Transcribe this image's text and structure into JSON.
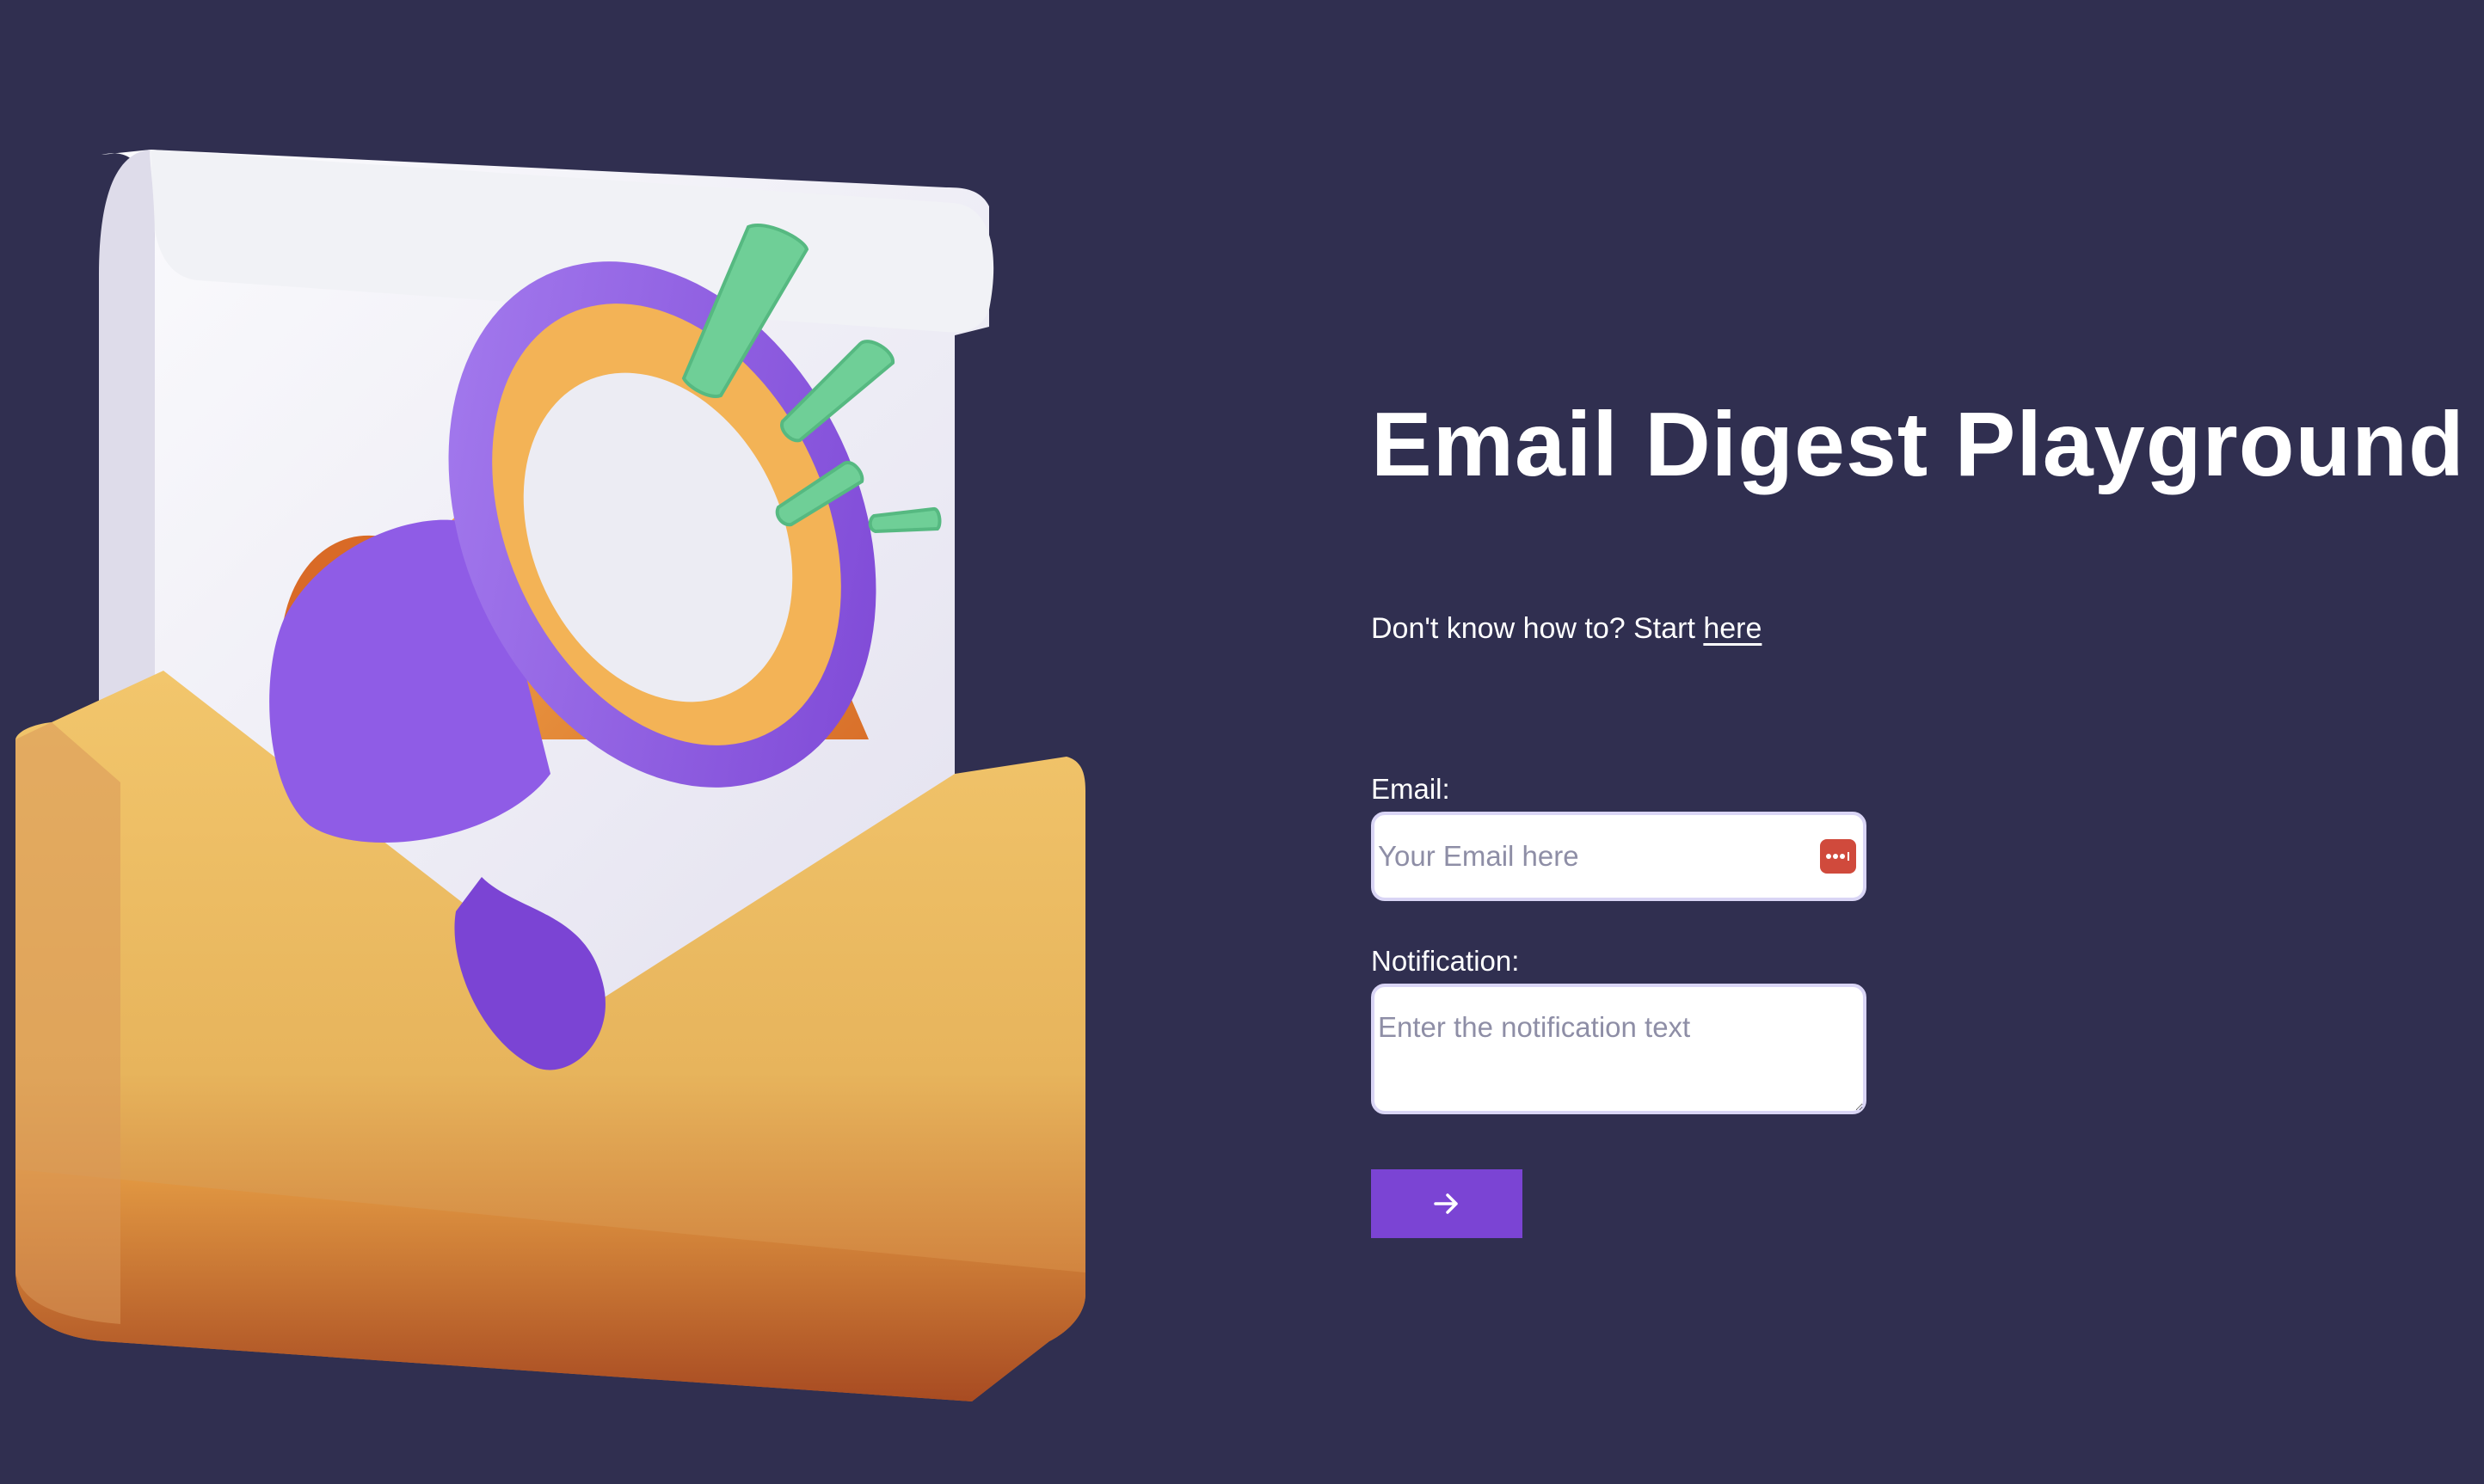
{
  "page": {
    "title": "Email Digest Playground",
    "help": {
      "text": "Don't know how to? Start ",
      "link_label": "here"
    }
  },
  "form": {
    "email": {
      "label": "Email:",
      "placeholder": "Your Email here",
      "value": ""
    },
    "notification": {
      "label": "Notification:",
      "placeholder": "Enter the notification text",
      "value": ""
    },
    "submit": {
      "icon": "arrow-right-icon"
    }
  },
  "illustration": {
    "subject": "envelope with megaphone"
  },
  "icons": {
    "autofill": "password-manager-icon",
    "submit": "arrow-right-icon"
  },
  "colors": {
    "background": "#302f50",
    "accent": "#7b44d4",
    "text": "#ffffff",
    "input_border": "#d9d5f5",
    "placeholder": "#8e8ea6",
    "envelope": "#e7b45c",
    "megaphone": "#8f5ce6",
    "sparks": "#6fcf97"
  }
}
